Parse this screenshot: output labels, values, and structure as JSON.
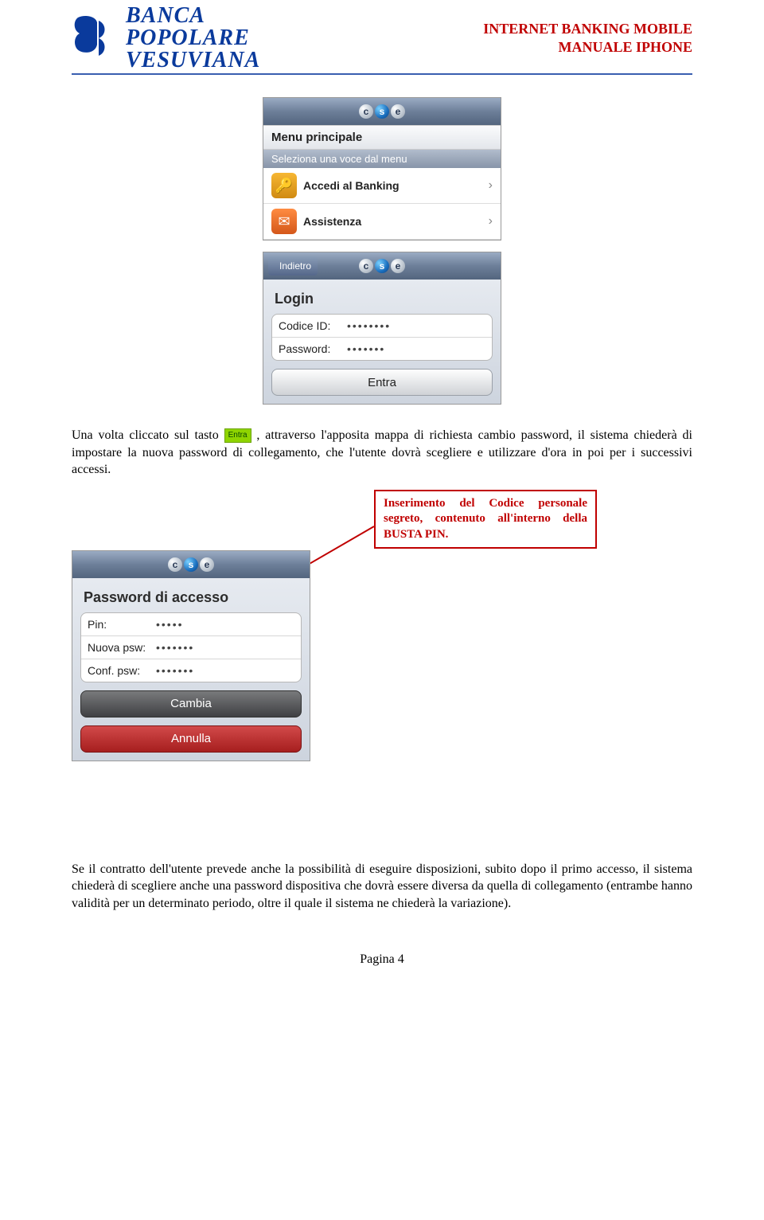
{
  "header": {
    "brand": {
      "line1": "BANCA",
      "line2": "POPOLARE",
      "line3": "VESUVIANA"
    },
    "right": {
      "line1": "INTERNET BANKING MOBILE",
      "line2": "MANUALE IPHONE"
    }
  },
  "screens": {
    "menu": {
      "cse": [
        "c",
        "s",
        "e"
      ],
      "title": "Menu principale",
      "subtitle": "Seleziona una voce dal menu",
      "items": [
        {
          "icon": "key-icon",
          "label": "Accedi al Banking"
        },
        {
          "icon": "mail-icon",
          "label": "Assistenza"
        }
      ]
    },
    "login": {
      "back": "Indietro",
      "cse": [
        "c",
        "s",
        "e"
      ],
      "title": "Login",
      "fields": [
        {
          "label": "Codice ID:",
          "value": "••••••••"
        },
        {
          "label": "Password:",
          "value": "•••••••"
        }
      ],
      "submit": "Entra"
    },
    "changepw": {
      "cse": [
        "c",
        "s",
        "e"
      ],
      "title": "Password di accesso",
      "fields": [
        {
          "label": "Pin:",
          "value": "•••••"
        },
        {
          "label": "Nuova psw:",
          "value": "•••••••"
        },
        {
          "label": "Conf. psw:",
          "value": "•••••••"
        }
      ],
      "confirm": "Cambia",
      "cancel": "Annulla"
    }
  },
  "para1": {
    "pre": "Una volta cliccato sul tasto ",
    "chip": "Entra",
    "post": ", attraverso l'apposita mappa di richiesta cambio password, il sistema chiederà di impostare la nuova password di collegamento, che l'utente dovrà scegliere e utilizzare d'ora in poi per i successivi accessi."
  },
  "callout": "Inserimento del Codice personale segreto, contenuto all'interno della BUSTA PIN.",
  "para2": "Se il contratto dell'utente prevede anche la possibilità di eseguire disposizioni, subito dopo il primo accesso, il sistema chiederà di scegliere anche una password dispositiva che dovrà essere diversa da quella di collegamento (entrambe hanno validità per un determinato periodo, oltre il quale il sistema ne chiederà la variazione).",
  "footer": "Pagina 4"
}
